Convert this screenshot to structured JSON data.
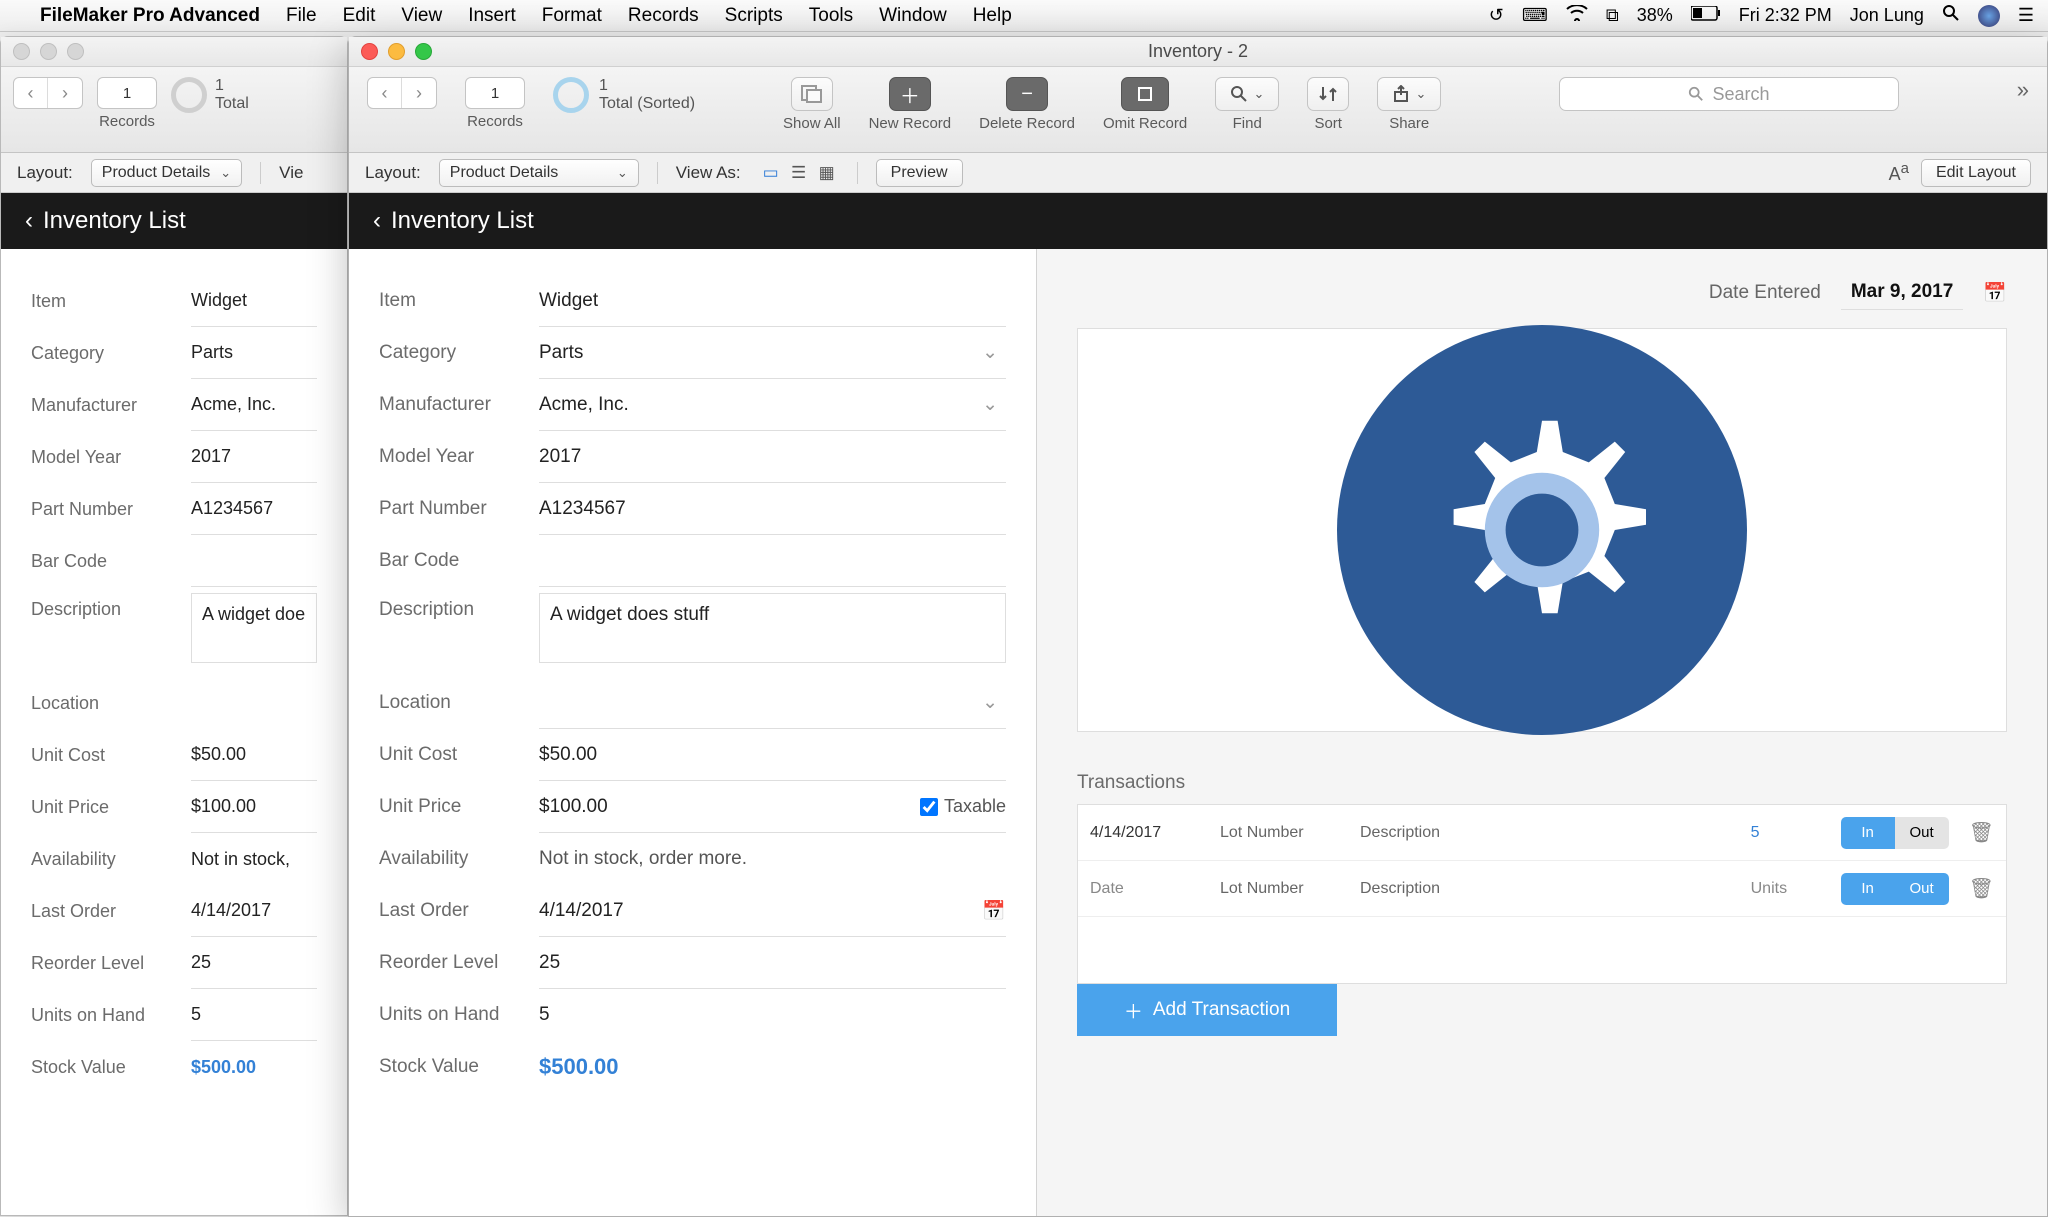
{
  "menubar": {
    "app": "FileMaker Pro Advanced",
    "items": [
      "File",
      "Edit",
      "View",
      "Insert",
      "Format",
      "Records",
      "Scripts",
      "Tools",
      "Window",
      "Help"
    ],
    "battery": "38%",
    "clock": "Fri 2:32 PM",
    "user": "Jon Lung"
  },
  "window_title": "Inventory - 2",
  "toolbar": {
    "record_num": "1",
    "record_total_line1": "1",
    "record_total_line2": "Total (Sorted)",
    "record_total_bg": "Total",
    "records_label": "Records",
    "showall": "Show All",
    "newrec": "New Record",
    "delrec": "Delete Record",
    "omitrec": "Omit Record",
    "find": "Find",
    "sort": "Sort",
    "share": "Share",
    "search_placeholder": "Search"
  },
  "layoutbar": {
    "layout_label": "Layout:",
    "layout_value": "Product Details",
    "viewas_label": "View As:",
    "preview": "Preview",
    "editlayout": "Edit Layout",
    "viewas_trunc": "Vie"
  },
  "header_band": "Inventory List",
  "form": {
    "item": {
      "label": "Item",
      "value": "Widget"
    },
    "category": {
      "label": "Category",
      "value": "Parts"
    },
    "manufacturer": {
      "label": "Manufacturer",
      "value": "Acme, Inc."
    },
    "modelyear": {
      "label": "Model Year",
      "value": "2017"
    },
    "partnum": {
      "label": "Part Number",
      "value": "A1234567"
    },
    "barcode": {
      "label": "Bar Code",
      "value": ""
    },
    "description": {
      "label": "Description",
      "value": "A widget does stuff",
      "value_trunc": "A widget doe"
    },
    "location": {
      "label": "Location",
      "value": ""
    },
    "unitcost": {
      "label": "Unit Cost",
      "value": "$50.00"
    },
    "unitprice": {
      "label": "Unit Price",
      "value": "$100.00"
    },
    "taxable": {
      "label": "Taxable",
      "checked": true
    },
    "availability": {
      "label": "Availability",
      "value": "Not in stock, order more.",
      "value_trunc": "Not in stock,"
    },
    "lastorder": {
      "label": "Last Order",
      "value": "4/14/2017"
    },
    "reorder": {
      "label": "Reorder Level",
      "value": "25"
    },
    "onhand": {
      "label": "Units on Hand",
      "value": "5"
    },
    "stockvalue": {
      "label": "Stock Value",
      "value": "$500.00"
    }
  },
  "right": {
    "date_entered_label": "Date Entered",
    "date_entered_value": "Mar 9, 2017",
    "transactions_label": "Transactions",
    "rows": [
      {
        "date": "4/14/2017",
        "lot": "Lot Number",
        "desc": "Description",
        "units": "5",
        "in": true
      },
      {
        "date": "Date",
        "lot": "Lot Number",
        "desc": "Description",
        "units": "Units",
        "in": false
      }
    ],
    "in": "In",
    "out": "Out",
    "add_label": "Add Transaction"
  }
}
